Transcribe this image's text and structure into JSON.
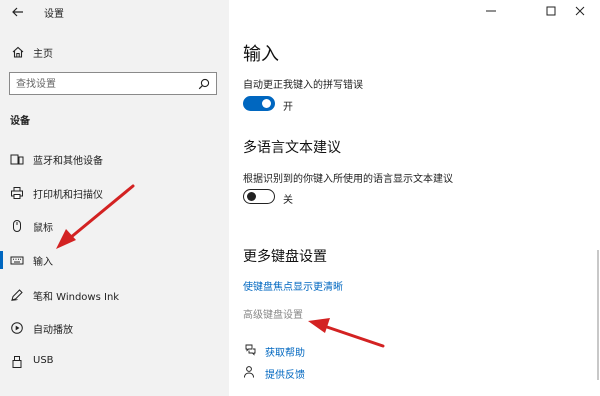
{
  "window": {
    "title": "设置",
    "back_icon": "arrow-left-icon",
    "controls": [
      "minimize-icon",
      "maximize-icon",
      "close-icon"
    ]
  },
  "sidebar": {
    "home_label": "主页",
    "search_placeholder": "查找设置",
    "section_title": "设备",
    "items": [
      {
        "label": "蓝牙和其他设备",
        "icon": "bluetooth-devices-icon",
        "selected": false
      },
      {
        "label": "打印机和扫描仪",
        "icon": "printer-icon",
        "selected": false
      },
      {
        "label": "鼠标",
        "icon": "mouse-icon",
        "selected": false
      },
      {
        "label": "输入",
        "icon": "keyboard-icon",
        "selected": true
      },
      {
        "label": "笔和 Windows Ink",
        "icon": "pen-icon",
        "selected": false
      },
      {
        "label": "自动播放",
        "icon": "autoplay-icon",
        "selected": false
      },
      {
        "label": "USB",
        "icon": "usb-icon",
        "selected": false
      }
    ]
  },
  "main": {
    "heading": "输入",
    "autocorrect": {
      "label": "自动更正我键入的拼写错误",
      "state": "开",
      "on": true
    },
    "multilingual": {
      "heading": "多语言文本建议",
      "label": "根据识别到的你键入所使用的语言显示文本建议",
      "state": "关",
      "on": false
    },
    "more_keyboard": {
      "heading": "更多键盘设置",
      "link1": "使键盘焦点显示更清晰",
      "link2": "高级键盘设置"
    },
    "help": [
      {
        "label": "获取帮助",
        "icon": "help-chat-icon"
      },
      {
        "label": "提供反馈",
        "icon": "feedback-icon"
      }
    ]
  },
  "colors": {
    "accent": "#0067c0",
    "annotation_arrow": "#d32222"
  }
}
